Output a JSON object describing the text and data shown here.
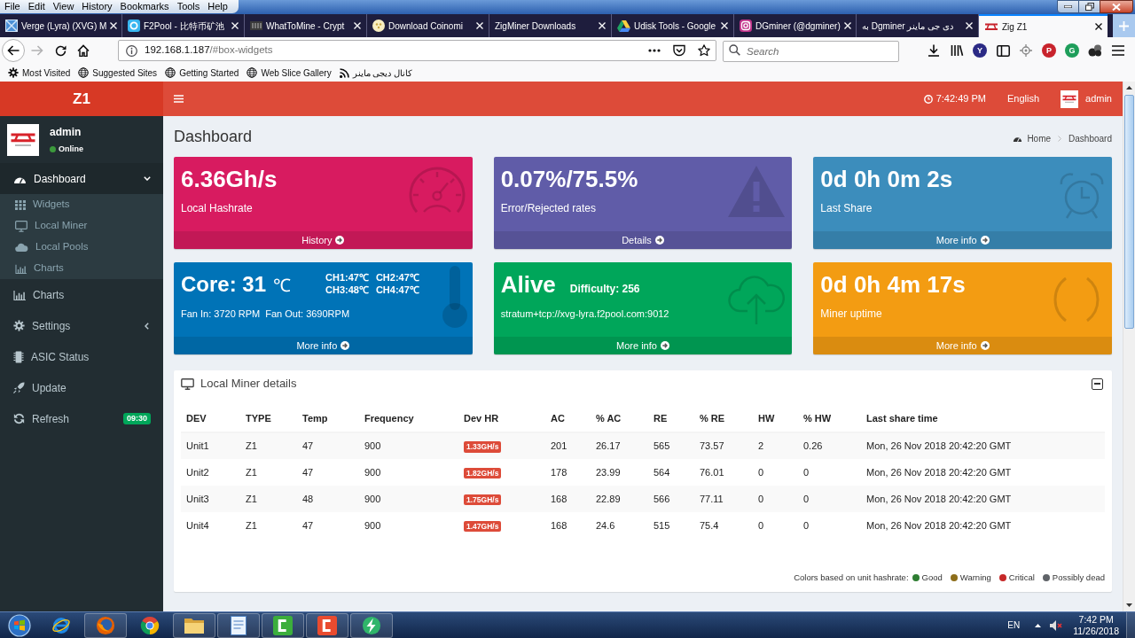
{
  "browser": {
    "menu_bar": [
      "File",
      "Edit",
      "View",
      "History",
      "Bookmarks",
      "Tools",
      "Help"
    ],
    "tabs": [
      {
        "title": "Verge (Lyra) (XVG) M",
        "selected": false
      },
      {
        "title": "F2Pool - 比特币矿池",
        "selected": false
      },
      {
        "title": "WhatToMine - Crypt",
        "selected": false
      },
      {
        "title": "Download Coinomi",
        "selected": false
      },
      {
        "title": "ZigMiner Downloads",
        "selected": false
      },
      {
        "title": "Udisk Tools - Google",
        "selected": false
      },
      {
        "title": "DGminer (@dgminer)",
        "selected": false
      },
      {
        "title": "دی جی ماینر Dgminer به",
        "selected": false
      },
      {
        "title": "Zig Z1",
        "selected": true
      }
    ],
    "forward_button": {
      "disabled": true
    },
    "address_bar": {
      "host": "192.168.1.187",
      "path": "/#box-widgets"
    },
    "search": {
      "placeholder": "Search"
    },
    "extensions": [
      {
        "letter": "Y",
        "color": "#2b2a85"
      },
      {
        "letter": "P",
        "color": "#c8232c"
      },
      {
        "letter": "G",
        "color": "#1e9e5a"
      }
    ],
    "bookmarks": [
      "Most Visited",
      "Suggested Sites",
      "Getting Started",
      "Web Slice Gallery",
      "کانال دیجی ماینر"
    ]
  },
  "header": {
    "logo": "Z1",
    "time": "7:42:49 PM",
    "language": "English",
    "user": "admin"
  },
  "sidebar": {
    "user": {
      "name": "admin",
      "status": "Online"
    },
    "menu": [
      {
        "label": "Dashboard",
        "selected": true,
        "expanded": true,
        "children": [
          {
            "label": "Widgets",
            "selected": false
          },
          {
            "label": "Local Miner",
            "selected": false
          },
          {
            "label": "Local Pools",
            "selected": false
          },
          {
            "label": "Charts",
            "selected": false
          }
        ]
      },
      {
        "label": "Charts",
        "selected": false
      },
      {
        "label": "Settings",
        "selected": false,
        "expanded": false
      },
      {
        "label": "ASIC Status",
        "selected": false
      },
      {
        "label": "Update",
        "selected": false
      },
      {
        "label": "Refresh",
        "selected": false,
        "badge": "09:30"
      }
    ]
  },
  "page": {
    "title": "Dashboard",
    "breadcrumb": [
      "Home",
      "Dashboard"
    ]
  },
  "info_boxes": [
    {
      "kind": "stat",
      "color": "#d81b60",
      "value": "6.36Gh/s",
      "label": "Local Hashrate",
      "link": "History"
    },
    {
      "kind": "stat",
      "color": "#605ca8",
      "value": "0.07%/75.5%",
      "label": "Error/Rejected rates",
      "link": "Details"
    },
    {
      "kind": "stat",
      "color": "#3c8dbc",
      "value": "0d 0h 0m 2s",
      "label": "Last Share",
      "link": "More info"
    },
    {
      "kind": "temperature",
      "color": "#0073b7",
      "value": "Core: 31",
      "unit": "℃",
      "channels": [
        "CH1:47℃",
        "CH2:47℃",
        "CH3:48℃",
        "CH4:47℃"
      ],
      "fans": [
        "Fan In: 3720 RPM",
        "Fan Out: 3690RPM"
      ],
      "link": "More info"
    },
    {
      "kind": "pool",
      "color": "#00a65a",
      "value": "Alive",
      "difficulty": "Difficulty: 256",
      "label": "stratum+tcp://xvg-lyra.f2pool.com:9012",
      "link": "More info"
    },
    {
      "kind": "stat",
      "color": "#f39c12",
      "value": "0d 0h 4m 17s",
      "label": "Miner uptime",
      "link": "More info"
    }
  ],
  "details_panel": {
    "title": "Local Miner details",
    "columns": [
      "DEV",
      "TYPE",
      "Temp",
      "Frequency",
      "Dev HR",
      "AC",
      "% AC",
      "RE",
      "% RE",
      "HW",
      "% HW",
      "Last share time"
    ],
    "rows": [
      {
        "cells": [
          "Unit1",
          "Z1",
          "47",
          "900",
          {
            "text": "1.33GH/s",
            "color": "#dd4b39"
          },
          "201",
          "26.17",
          "565",
          "73.57",
          "2",
          "0.26",
          "Mon, 26 Nov 2018 20:42:20 GMT"
        ]
      },
      {
        "cells": [
          "Unit2",
          "Z1",
          "47",
          "900",
          {
            "text": "1.82GH/s",
            "color": "#dd4b39"
          },
          "178",
          "23.99",
          "564",
          "76.01",
          "0",
          "0",
          "Mon, 26 Nov 2018 20:42:20 GMT"
        ]
      },
      {
        "cells": [
          "Unit3",
          "Z1",
          "48",
          "900",
          {
            "text": "1.75GH/s",
            "color": "#dd4b39"
          },
          "168",
          "22.89",
          "566",
          "77.11",
          "0",
          "0",
          "Mon, 26 Nov 2018 20:42:20 GMT"
        ]
      },
      {
        "cells": [
          "Unit4",
          "Z1",
          "47",
          "900",
          {
            "text": "1.47GH/s",
            "color": "#dd4b39"
          },
          "168",
          "24.6",
          "515",
          "75.4",
          "0",
          "0",
          "Mon, 26 Nov 2018 20:42:20 GMT"
        ]
      }
    ],
    "legend": {
      "label": "Colors based on unit hashrate:",
      "items": [
        {
          "label": "Good",
          "color": "#2e7d32"
        },
        {
          "label": "Warning",
          "color": "#8d6e1a"
        },
        {
          "label": "Critical",
          "color": "#c62828"
        },
        {
          "label": "Possibly dead",
          "color": "#5f6368"
        }
      ]
    }
  },
  "taskbar": {
    "apps": [
      {
        "running": false
      },
      {
        "running": true
      },
      {
        "running": false
      },
      {
        "running": true
      },
      {
        "running": true
      },
      {
        "running": true
      },
      {
        "running": true
      },
      {
        "running": true
      }
    ],
    "language": "EN",
    "time": "7:42 PM",
    "date": "11/26/2018"
  }
}
